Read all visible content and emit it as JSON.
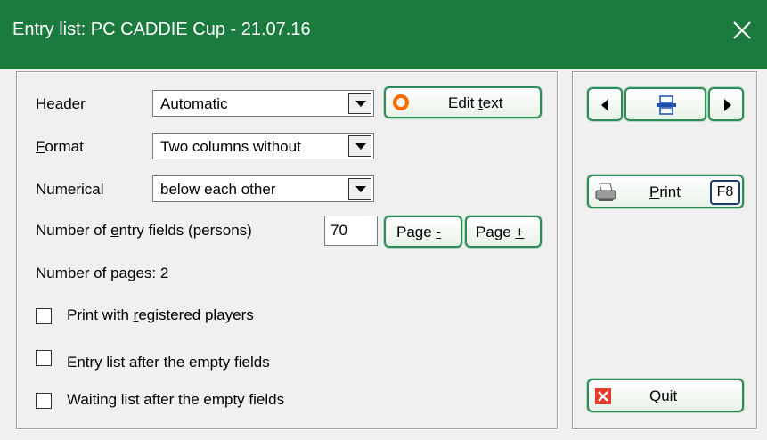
{
  "window": {
    "title": "Entry list: PC CADDIE Cup - 21.07.16"
  },
  "form": {
    "header": {
      "label_u": "H",
      "label_rest": "eader",
      "value": "Automatic"
    },
    "format": {
      "label_u": "F",
      "label_rest": "ormat",
      "value": "Two columns without"
    },
    "numerical": {
      "label": "Numerical",
      "value": "below each other"
    },
    "entry_fields": {
      "label_pre": "Number of ",
      "label_u": "e",
      "label_post": "ntry fields (persons)",
      "value": "70"
    },
    "edit_text": {
      "pre": "Edit ",
      "u": "t",
      "post": "ext"
    },
    "page_minus": {
      "pre": "Page ",
      "u": "-"
    },
    "page_plus": {
      "pre": "Page ",
      "u": "+"
    },
    "pages_info": "Number of pages: 2",
    "checkboxes": [
      {
        "pre": "Print with ",
        "u": "r",
        "post": "egistered players",
        "checked": false
      },
      {
        "pre": "Entry list after the empty fields",
        "u": "",
        "post": "",
        "checked": false
      },
      {
        "pre": "Waiting list after the empty fields",
        "u": "",
        "post": "",
        "checked": false
      }
    ]
  },
  "side": {
    "print": {
      "u": "P",
      "rest": "rint",
      "shortcut": "F8"
    },
    "quit": {
      "label": "Quit"
    }
  },
  "icons": {
    "edit": "record-icon",
    "print": "printer-icon",
    "quit": "red-x-icon",
    "nav": [
      "arrow-left-icon",
      "printer-settings-icon",
      "arrow-right-icon"
    ]
  },
  "colors": {
    "titlebar": "#1b7a3e",
    "button_border": "#2e8b57",
    "accent_orange": "#ff6a00"
  }
}
